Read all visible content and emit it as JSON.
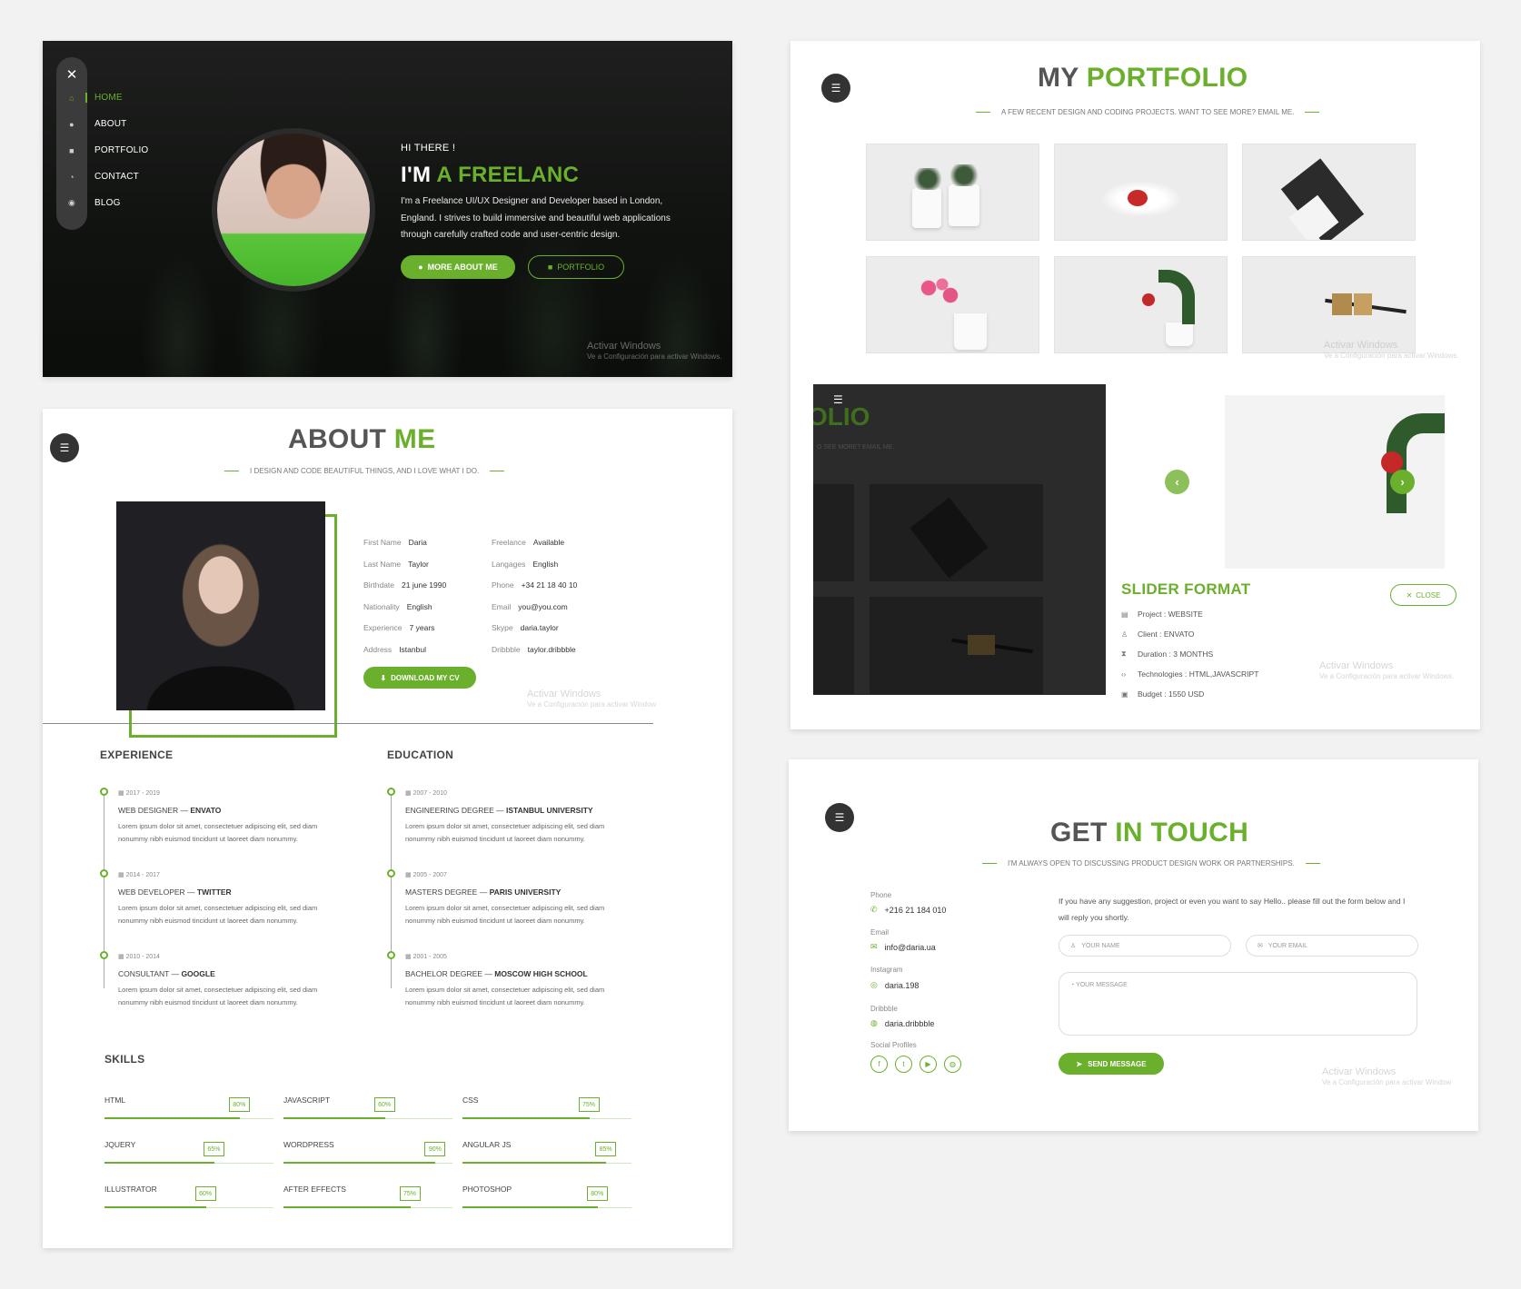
{
  "hero": {
    "nav_close": "✕",
    "nav_items": [
      {
        "label": "HOME",
        "icon": "home-icon"
      },
      {
        "label": "ABOUT",
        "icon": "user-icon"
      },
      {
        "label": "PORTFOLIO",
        "icon": "briefcase-icon"
      },
      {
        "label": "CONTACT",
        "icon": "chat-icon"
      },
      {
        "label": "BLOG",
        "icon": "comment-icon"
      }
    ],
    "greeting": "HI THERE !",
    "headline_prefix": "I'M",
    "headline_accent": "A FREELANC",
    "bio": "I'm a Freelance UI/UX Designer and Developer based in London, England. I strives to build immersive and beautiful web applications through carefully crafted code and user-centric design.",
    "btn_more": "MORE ABOUT ME",
    "btn_portfolio": "PORTFOLIO",
    "watermark_title": "Activar Windows",
    "watermark_sub": "Ve a Configuración para activar Windows."
  },
  "portfolio": {
    "title_prefix": "MY",
    "title_accent": "PORTFOLIO",
    "subtitle": "A FEW RECENT DESIGN AND CODING PROJECTS. WANT TO SEE MORE? EMAIL ME.",
    "overlay_title": "OLIO",
    "overlay_sub": "O SEE MORE? EMAIL ME.",
    "slider_title": "SLIDER FORMAT",
    "close_label": "CLOSE",
    "meta": [
      {
        "icon": "file-icon",
        "label": "Project :",
        "value": "WEBSITE"
      },
      {
        "icon": "user-icon",
        "label": "Client :",
        "value": "ENVATO"
      },
      {
        "icon": "hourglass-icon",
        "label": "Duration :",
        "value": "3 MONTHS"
      },
      {
        "icon": "code-icon",
        "label": "Technologies :",
        "value": "HTML,JAVASCRIPT"
      },
      {
        "icon": "money-icon",
        "label": "Budget :",
        "value": "1550 USD"
      }
    ],
    "watermark_title": "Activar Windows",
    "watermark_sub": "Ve a Configuración para activar Windows."
  },
  "about": {
    "title_prefix": "ABOUT",
    "title_accent": "ME",
    "subtitle": "I DESIGN AND CODE BEAUTIFUL THINGS, AND I LOVE WHAT I DO.",
    "info_left": [
      {
        "k": "First Name",
        "v": "Daria"
      },
      {
        "k": "Last Name",
        "v": "Taylor"
      },
      {
        "k": "Birthdate",
        "v": "21 june 1990"
      },
      {
        "k": "Nationality",
        "v": "English"
      },
      {
        "k": "Experience",
        "v": "7 years"
      },
      {
        "k": "Address",
        "v": "Istanbul"
      }
    ],
    "info_right": [
      {
        "k": "Freelance",
        "v": "Available"
      },
      {
        "k": "Langages",
        "v": "English"
      },
      {
        "k": "Phone",
        "v": "+34 21 18 40 10"
      },
      {
        "k": "Email",
        "v": "you@you.com"
      },
      {
        "k": "Skype",
        "v": "daria.taylor"
      },
      {
        "k": "Dribbble",
        "v": "taylor.dribbble"
      }
    ],
    "download_label": "DOWNLOAD MY CV",
    "experience_title": "EXPERIENCE",
    "education_title": "EDUCATION",
    "experience": [
      {
        "date": "2017 - 2019",
        "role": "WEB DESIGNER",
        "org": "ENVATO",
        "desc": "Lorem ipsum dolor sit amet, consectetuer adipiscing elit, sed diam nonummy nibh euismod tincidunt ut laoreet diam nonummy."
      },
      {
        "date": "2014 - 2017",
        "role": "WEB DEVELOPER",
        "org": "TWITTER",
        "desc": "Lorem ipsum dolor sit amet, consectetuer adipiscing elit, sed diam nonummy nibh euismod tincidunt ut laoreet diam nonummy."
      },
      {
        "date": "2010 - 2014",
        "role": "CONSULTANT",
        "org": "GOOGLE",
        "desc": "Lorem ipsum dolor sit amet, consectetuer adipiscing elit, sed diam nonummy nibh euismod tincidunt ut laoreet diam nonummy."
      }
    ],
    "education": [
      {
        "date": "2007 - 2010",
        "role": "ENGINEERING DEGREE",
        "org": "ISTANBUL UNIVERSITY",
        "desc": "Lorem ipsum dolor sit amet, consectetuer adipiscing elit, sed diam nonummy nibh euismod tincidunt ut laoreet diam nonummy."
      },
      {
        "date": "2005 - 2007",
        "role": "MASTERS DEGREE",
        "org": "PARIS UNIVERSITY",
        "desc": "Lorem ipsum dolor sit amet, consectetuer adipiscing elit, sed diam nonummy nibh euismod tincidunt ut laoreet diam nonummy."
      },
      {
        "date": "2001 - 2005",
        "role": "BACHELOR DEGREE",
        "org": "MOSCOW HIGH SCHOOL",
        "desc": "Lorem ipsum dolor sit amet, consectetuer adipiscing elit, sed diam nonummy nibh euismod tincidunt ut laoreet diam nonummy."
      }
    ],
    "skills_title": "SKILLS",
    "skills": [
      {
        "name": "HTML",
        "percent": 80,
        "label": "80%"
      },
      {
        "name": "JAVASCRIPT",
        "percent": 60,
        "label": "60%"
      },
      {
        "name": "CSS",
        "percent": 75,
        "label": "75%"
      },
      {
        "name": "JQUERY",
        "percent": 65,
        "label": "65%"
      },
      {
        "name": "WORDPRESS",
        "percent": 90,
        "label": "90%"
      },
      {
        "name": "ANGULAR JS",
        "percent": 85,
        "label": "85%"
      },
      {
        "name": "ILLUSTRATOR",
        "percent": 60,
        "label": "60%"
      },
      {
        "name": "AFTER EFFECTS",
        "percent": 75,
        "label": "75%"
      },
      {
        "name": "PHOTOSHOP",
        "percent": 80,
        "label": "80%"
      }
    ],
    "watermark_title": "Activar Windows",
    "watermark_sub": "Ve a Configuración para activar Window"
  },
  "contact": {
    "title_prefix": "GET",
    "title_accent": "IN TOUCH",
    "subtitle": "I'M ALWAYS OPEN TO DISCUSSING PRODUCT DESIGN WORK OR PARTNERSHIPS.",
    "phone_label": "Phone",
    "phone": "+216 21 184 010",
    "email_label": "Email",
    "email": "info@daria.ua",
    "instagram_label": "Instagram",
    "instagram": "daria.198",
    "dribbble_label": "Dribbble",
    "dribbble": "daria.dribbble",
    "social_label": "Social Profiles",
    "social": [
      "facebook-icon",
      "twitter-icon",
      "youtube-icon",
      "dribbble-icon"
    ],
    "intro": "If you have any suggestion, project or even you want to say Hello.. please fill out the form below and I will reply you shortly.",
    "name_placeholder": "YOUR NAME",
    "email_placeholder": "YOUR EMAIL",
    "message_placeholder": "YOUR MESSAGE",
    "send_label": "SEND MESSAGE",
    "watermark_title": "Activar Windows",
    "watermark_sub": "Ve a Configuración para activar Window"
  }
}
